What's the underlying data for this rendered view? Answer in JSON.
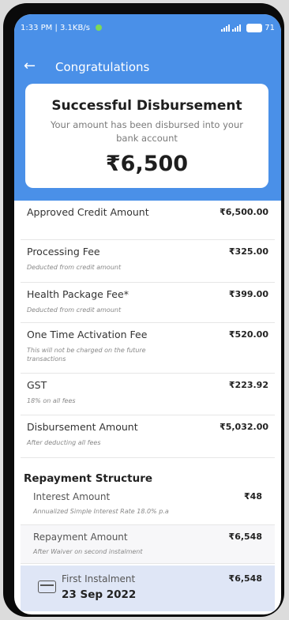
{
  "status_bar": {
    "time_speed": "1:33 PM | 3.1KB/s",
    "battery": "71"
  },
  "app_bar": {
    "back_icon": "arrow-left-icon",
    "title": "Congratulations"
  },
  "summary": {
    "title": "Successful Disbursement",
    "subtitle": "Your amount has been disbursed into your bank account",
    "amount": "₹6,500"
  },
  "fees": [
    {
      "label": "Approved Credit Amount",
      "value": "₹6,500.00",
      "note": ""
    },
    {
      "label": "Processing Fee",
      "value": "₹325.00",
      "note": "Deducted from credit amount"
    },
    {
      "label": "Health Package Fee*",
      "value": "₹399.00",
      "note": "Deducted from credit amount"
    },
    {
      "label": "One Time Activation Fee",
      "value": "₹520.00",
      "note": "This will not be charged on the future transactions"
    },
    {
      "label": "GST",
      "value": "₹223.92",
      "note": "18% on all fees"
    },
    {
      "label": "Disbursement Amount",
      "value": "₹5,032.00",
      "note": "After deducting all fees"
    }
  ],
  "repayment": {
    "title": "Repayment Structure",
    "items": [
      {
        "label": "Interest Amount",
        "value": "₹48",
        "note": "Annualized Simple Interest Rate 18.0%  p.a"
      },
      {
        "label": "Repayment Amount",
        "value": "₹6,548",
        "note": "After Waiver on second instalment"
      }
    ],
    "instalment": {
      "icon": "credit-card-icon",
      "label": "First Instalment",
      "date": "23 Sep 2022",
      "value": "₹6,548"
    }
  },
  "colors": {
    "header": "#4a90e8",
    "instalment_bg": "#dfe6f6"
  }
}
